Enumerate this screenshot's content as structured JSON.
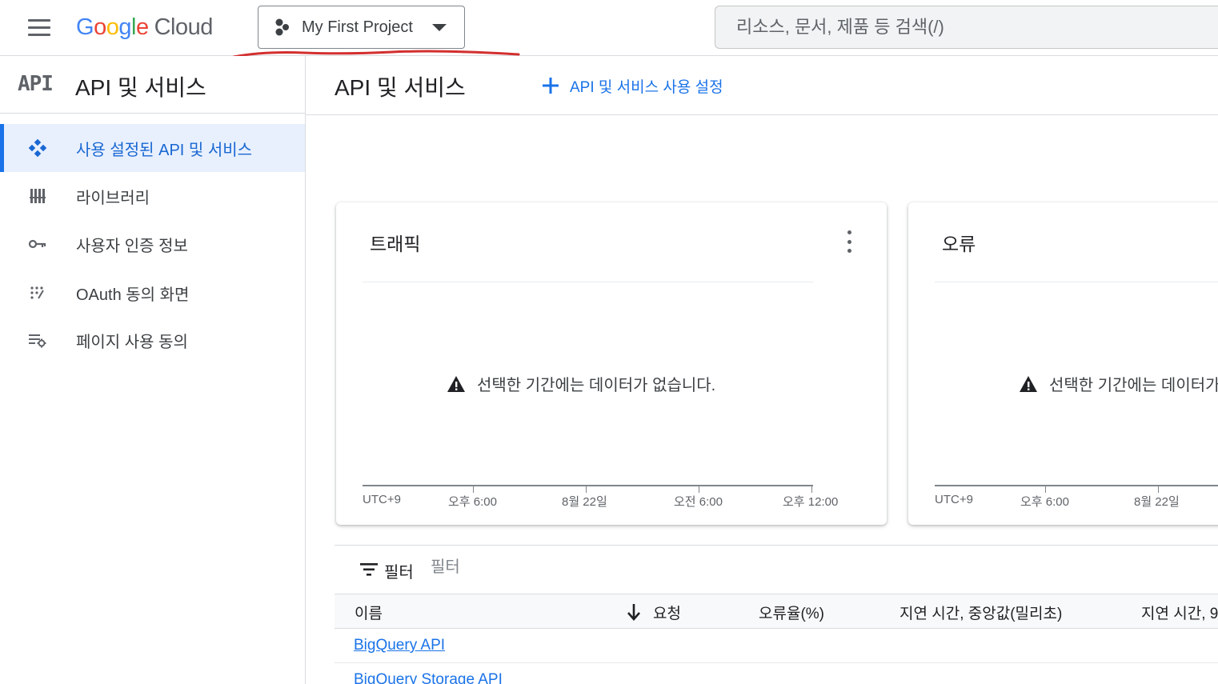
{
  "header": {
    "logo_parts": [
      "G",
      "o",
      "o",
      "g",
      "l",
      "e"
    ],
    "logo_cloud": "Cloud",
    "project_name": "My First Project",
    "search_placeholder": "리소스, 문서, 제품 등 검색(/)"
  },
  "sidebar": {
    "badge": "API",
    "title": "API 및 서비스",
    "items": [
      {
        "label": "사용 설정된 API 및 서비스",
        "icon": "diamond-dots-icon",
        "active": true
      },
      {
        "label": "라이브러리",
        "icon": "library-icon",
        "active": false
      },
      {
        "label": "사용자 인증 정보",
        "icon": "key-icon",
        "active": false
      },
      {
        "label": "OAuth 동의 화면",
        "icon": "dots-grid-icon",
        "active": false
      },
      {
        "label": "페이지 사용 동의",
        "icon": "list-settings-icon",
        "active": false
      }
    ]
  },
  "main": {
    "title": "API 및 서비스",
    "enable_button": "API 및 서비스 사용 설정"
  },
  "cards": {
    "traffic": {
      "title": "트래픽",
      "no_data": "선택한 기간에는 데이터가 없습니다.",
      "ticks": [
        "UTC+9",
        "오후 6:00",
        "8월 22일",
        "오전 6:00",
        "오후 12:00"
      ]
    },
    "errors": {
      "title": "오류",
      "no_data": "선택한 기간에는 데이터가",
      "ticks": [
        "UTC+9",
        "오후 6:00",
        "8월 22일"
      ]
    }
  },
  "filter": {
    "label": "필터",
    "placeholder": "필터"
  },
  "table": {
    "columns": [
      "이름",
      "요청",
      "오류율(%)",
      "지연 시간, 중앙값(밀리초)",
      "지연 시간, 9"
    ],
    "rows": [
      "BigQuery API",
      "BigQuery Storage API"
    ]
  },
  "colors": {
    "accent": "#1a73e8",
    "annotation": "#d32f2f"
  }
}
